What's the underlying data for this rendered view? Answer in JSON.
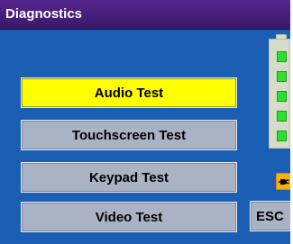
{
  "window": {
    "title": "Diagnostics"
  },
  "menu": {
    "items": [
      {
        "label": "Audio Test",
        "selected": true
      },
      {
        "label": "Touchscreen Test",
        "selected": false
      },
      {
        "label": "Keypad Test",
        "selected": false
      },
      {
        "label": "Video Test",
        "selected": false
      }
    ]
  },
  "status": {
    "battery_icon": "battery-icon",
    "battery_cells_lit": 5,
    "power_icon": "power-plug-icon"
  },
  "actions": {
    "esc_label": "ESC"
  },
  "colors": {
    "background": "#1a5fb4",
    "titlebar": "#4a2080",
    "selected": "#ffff00",
    "button": "#aab3c4",
    "battery_cell": "#2ee02e",
    "power_indicator": "#ffb000"
  }
}
